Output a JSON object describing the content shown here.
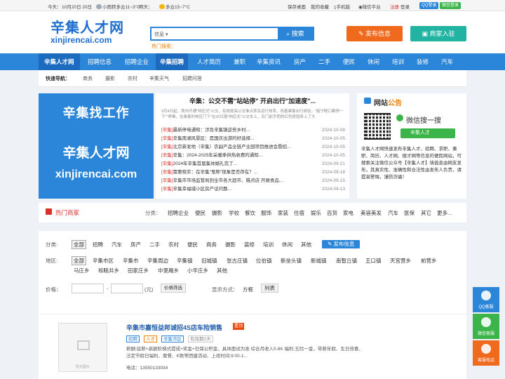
{
  "topbar": {
    "today": "今天：",
    "date": "10月20日 20日",
    "weather_today": "小雨转多云11~3°C",
    "tomorrow_label": "明天：",
    "weather_tomorrow": "多云15~7°C",
    "links": [
      "保存桌面",
      "我的收藏",
      "手机版",
      "微信平台"
    ],
    "register": "注册",
    "login": "登录",
    "qq_login": "QQ登录",
    "wx_login": "微信登录"
  },
  "header": {
    "logo_cn": "辛集人才网",
    "logo_en": "xinjirencai.com",
    "search_select": "信息",
    "search_button": "搜索",
    "hot_search": "热门搜索：",
    "publish_button": "发布信息",
    "merchant_button": "商家入驻"
  },
  "nav": {
    "items": [
      "辛集人才网",
      "招聘信息",
      "招聘企业",
      "辛集招聘",
      "人才简历",
      "兼职",
      "辛集资讯",
      "房产",
      "二手",
      "便民",
      "休闲",
      "培训",
      "装修",
      "汽车"
    ]
  },
  "quick": {
    "label": "快速导航：",
    "items": [
      "商务",
      "摄影",
      "农村",
      "辛集天气",
      "招聘问答"
    ]
  },
  "banner": {
    "line1": "辛集找工作",
    "line2": "辛集人才网",
    "line3": "xinjirencai.com"
  },
  "news": {
    "headline": "辛集：公交不需\"站站停\" 开启出行\"加速度\"...",
    "summary": "9月4日起，我市开通\"响应式\"公交，有效提高公交准点率及运行效率，改善乘客出行体验。\"能宁聪口都停一下\"\"停稀，在乘客的响应门下\"在20日路\"响应式\"公交车上，后门前手把的红色按钮来上了大",
    "items": [
      {
        "tag": "[辛集]",
        "text": "最新停电通知：涉及辛集镇这些乡村...",
        "date": "2024-10-08"
      },
      {
        "tag": "[辛集]",
        "text": "辛集南湖风景区：是国庆出游的好选择...",
        "date": "2024-10-05"
      },
      {
        "tag": "[辛集]",
        "text": "北京新发地（辛集）农副产品全链产业园项目推进会暨招...",
        "date": "2024-10-05"
      },
      {
        "tag": "[辛集]",
        "text": "辛集：2024-2025年采暖季供热收费的通知...",
        "date": "2024-10-05"
      },
      {
        "tag": "[辛集]",
        "text": "2024年辛集首届集体婚礼完了...",
        "date": "2024-09-21"
      },
      {
        "tag": "[辛集]",
        "text": "需要核实：在辛集\"鬼称\"现象是否存在？...",
        "date": "2024-09-18"
      },
      {
        "tag": "[辛集]",
        "text": "辛集市市场监管局到全市各大超市、糕点店 开展食品...",
        "date": "2024-09-15"
      },
      {
        "tag": "[辛集]",
        "text": "辛集幸福城小区房产证问题...",
        "date": "2024-09-13"
      }
    ]
  },
  "notice": {
    "title_a": "网站",
    "title_b": "公告",
    "wx_search": "微信搜一搜",
    "wx_button": "辛集人才",
    "desc": "辛集人才网快速发布辛集人才、招聘、求职、兼职、简历、人才网、搜才网等信息的便民网站，可搜索关注微信公众号【辛集人才】填值息由网友发布，其真实性、准确性和合法性由发布人负责，请提高警惕，谨防诈骗！"
  },
  "hotbiz": {
    "title": "热门商家",
    "cat_label": "分类：",
    "cats": [
      "招聘企业",
      "便民",
      "摄影",
      "学校",
      "餐饮",
      "服饰",
      "家装",
      "住宿",
      "娱乐",
      "百货",
      "家电",
      "美容美发",
      "汽车",
      "医保",
      "其它",
      "更多..."
    ]
  },
  "filter": {
    "cat_label": "分类:",
    "cats": [
      "全部",
      "招聘",
      "汽车",
      "房产",
      "二手",
      "农村",
      "便民",
      "商务",
      "摄影",
      "装修",
      "培训",
      "休闲",
      "其他"
    ],
    "publish": "发布信息",
    "area_label": "地区:",
    "areas_row1": [
      "全部",
      "辛集市区",
      "辛集市",
      "辛集周边",
      "辛集镇",
      "旧城镇",
      "张古庄镇",
      "位伯镇",
      "新垒头镇",
      "新城镇",
      "南智丘镇",
      "王口镇",
      "天宫营乡",
      "前营乡"
    ],
    "areas_row2": [
      "马庄乡",
      "和睦井乡",
      "田家庄乡",
      "中里厢乡",
      "小辛庄乡",
      "其他"
    ],
    "price_label": "价格：",
    "price_sep": "-",
    "price_unit": "(元)",
    "price_button": "价格筛选",
    "display_label": "显示方式：",
    "display_grid": "方框",
    "display_list": "列表"
  },
  "listing": {
    "title": "辛集市嘉恒益邦诚招4S店车险销售",
    "badge": "置顶",
    "tags": [
      "招聘",
      "人才",
      "辛集市区",
      "有效期2天"
    ],
    "desc": "薪酬:底薪+高额阶梯式提成+奖金+社保公积金，具体面试为准 综合月收入5-8K 福利:五险一金，带薪年假、生日倍喜、法定节假日福利、聚餐、K歌等团建活动、上班时间:9:00-1...",
    "phone": "电话：13550133934",
    "thumb_text": "暂无图片"
  },
  "side": {
    "qq": "QQ客服",
    "wx": "微信客服",
    "tel": "客服电话"
  },
  "colors": {
    "brand": "#2b86d9",
    "orange": "#e8830f",
    "green": "#3bb54a",
    "red": "#d9302b"
  }
}
